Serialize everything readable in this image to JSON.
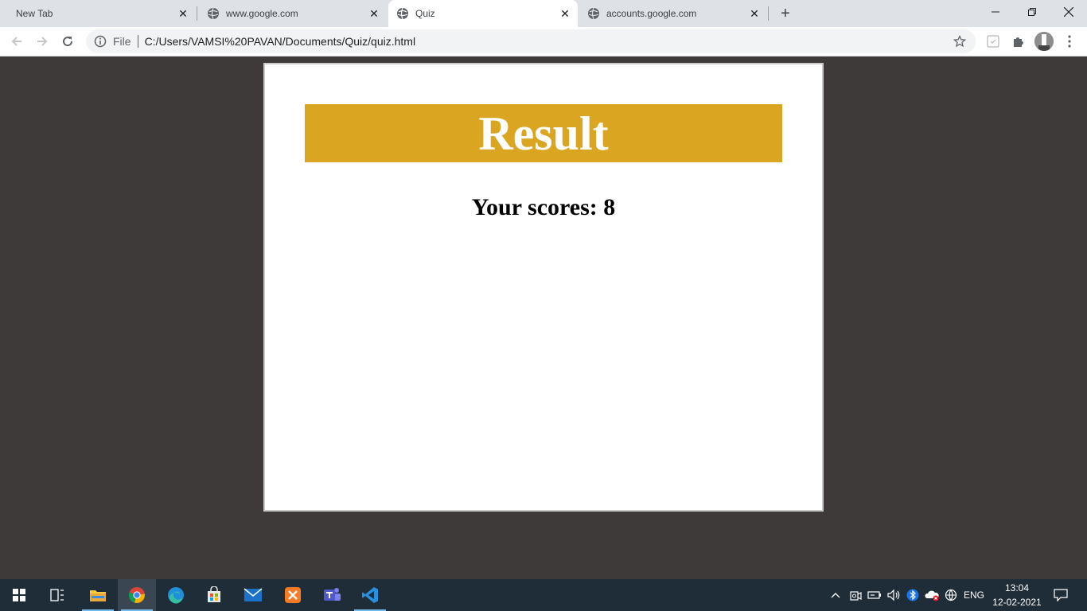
{
  "browser": {
    "tabs": [
      {
        "title": "New Tab",
        "active": false
      },
      {
        "title": "www.google.com",
        "active": false
      },
      {
        "title": "Quiz",
        "active": true
      },
      {
        "title": "accounts.google.com",
        "active": false
      }
    ],
    "address_bar": {
      "scheme_label": "File",
      "url": "C:/Users/VAMSI%20PAVAN/Documents/Quiz/quiz.html"
    }
  },
  "page": {
    "title": "Result",
    "score_text": "Your scores: 8"
  },
  "taskbar": {
    "language": "ENG",
    "time": "13:04",
    "date": "12-02-2021"
  },
  "colors": {
    "banner": "#daa520",
    "page_background": "#3d3a39",
    "taskbar": "#1f2d38"
  }
}
